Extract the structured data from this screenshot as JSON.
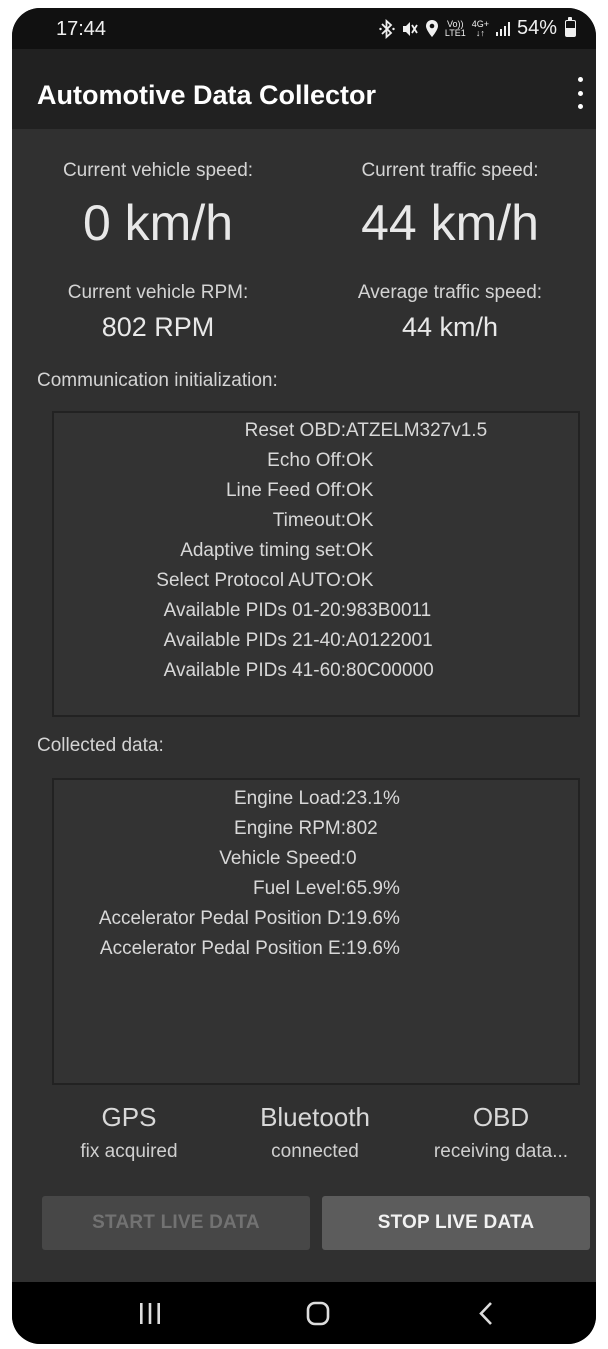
{
  "status_bar": {
    "time": "17:44",
    "network_top": "Vo))",
    "network_bottom": "LTE1",
    "data_top": "4G+",
    "data_bottom": "↓↑",
    "battery": "54%",
    "battery_level": 0.54,
    "icons": [
      "bluetooth-icon",
      "mute-icon",
      "location-icon",
      "signal-icon",
      "battery-icon"
    ]
  },
  "app_bar": {
    "title": "Automotive Data Collector"
  },
  "speed": {
    "vehicle_speed_label": "Current vehicle speed:",
    "vehicle_speed_value": "0 km/h",
    "traffic_speed_label": "Current traffic speed:",
    "traffic_speed_value": "44 km/h",
    "vehicle_rpm_label": "Current vehicle RPM:",
    "vehicle_rpm_value": "802 RPM",
    "avg_traffic_label": "Average traffic speed:",
    "avg_traffic_value": "44 km/h"
  },
  "init": {
    "label": "Communication initialization:",
    "rows": [
      {
        "key": "Reset OBD:",
        "value": "ATZELM327v1.5"
      },
      {
        "key": "Echo Off:",
        "value": "OK"
      },
      {
        "key": "Line Feed Off:",
        "value": "OK"
      },
      {
        "key": "Timeout:",
        "value": "OK"
      },
      {
        "key": "Adaptive timing set:",
        "value": "OK"
      },
      {
        "key": "Select Protocol AUTO:",
        "value": "OK"
      },
      {
        "key": "Available PIDs 01-20:",
        "value": "983B0011"
      },
      {
        "key": "Available PIDs 21-40:",
        "value": "A0122001"
      },
      {
        "key": "Available PIDs 41-60:",
        "value": "80C00000"
      }
    ]
  },
  "collected": {
    "label": "Collected data:",
    "rows": [
      {
        "key": "Engine Load:",
        "value": "23.1%"
      },
      {
        "key": "Engine RPM:",
        "value": "802"
      },
      {
        "key": "Vehicle Speed:",
        "value": "0"
      },
      {
        "key": "Fuel Level:",
        "value": "65.9%"
      },
      {
        "key": "Accelerator Pedal Position D:",
        "value": "19.6%"
      },
      {
        "key": "Accelerator Pedal Position E:",
        "value": "19.6%"
      }
    ]
  },
  "indicators": {
    "gps_title": "GPS",
    "gps_state": "fix acquired",
    "bluetooth_title": "Bluetooth",
    "bluetooth_state": "connected",
    "obd_title": "OBD",
    "obd_state": "receiving data..."
  },
  "buttons": {
    "start_label": "START LIVE DATA",
    "stop_label": "STOP LIVE DATA"
  },
  "nav": {
    "icons": [
      "recents-icon",
      "home-icon",
      "back-icon"
    ]
  },
  "colors": {
    "background": "#303030",
    "app_bar": "#212121",
    "stop_button": "#5c5c5c",
    "start_button_disabled": "#474747"
  }
}
